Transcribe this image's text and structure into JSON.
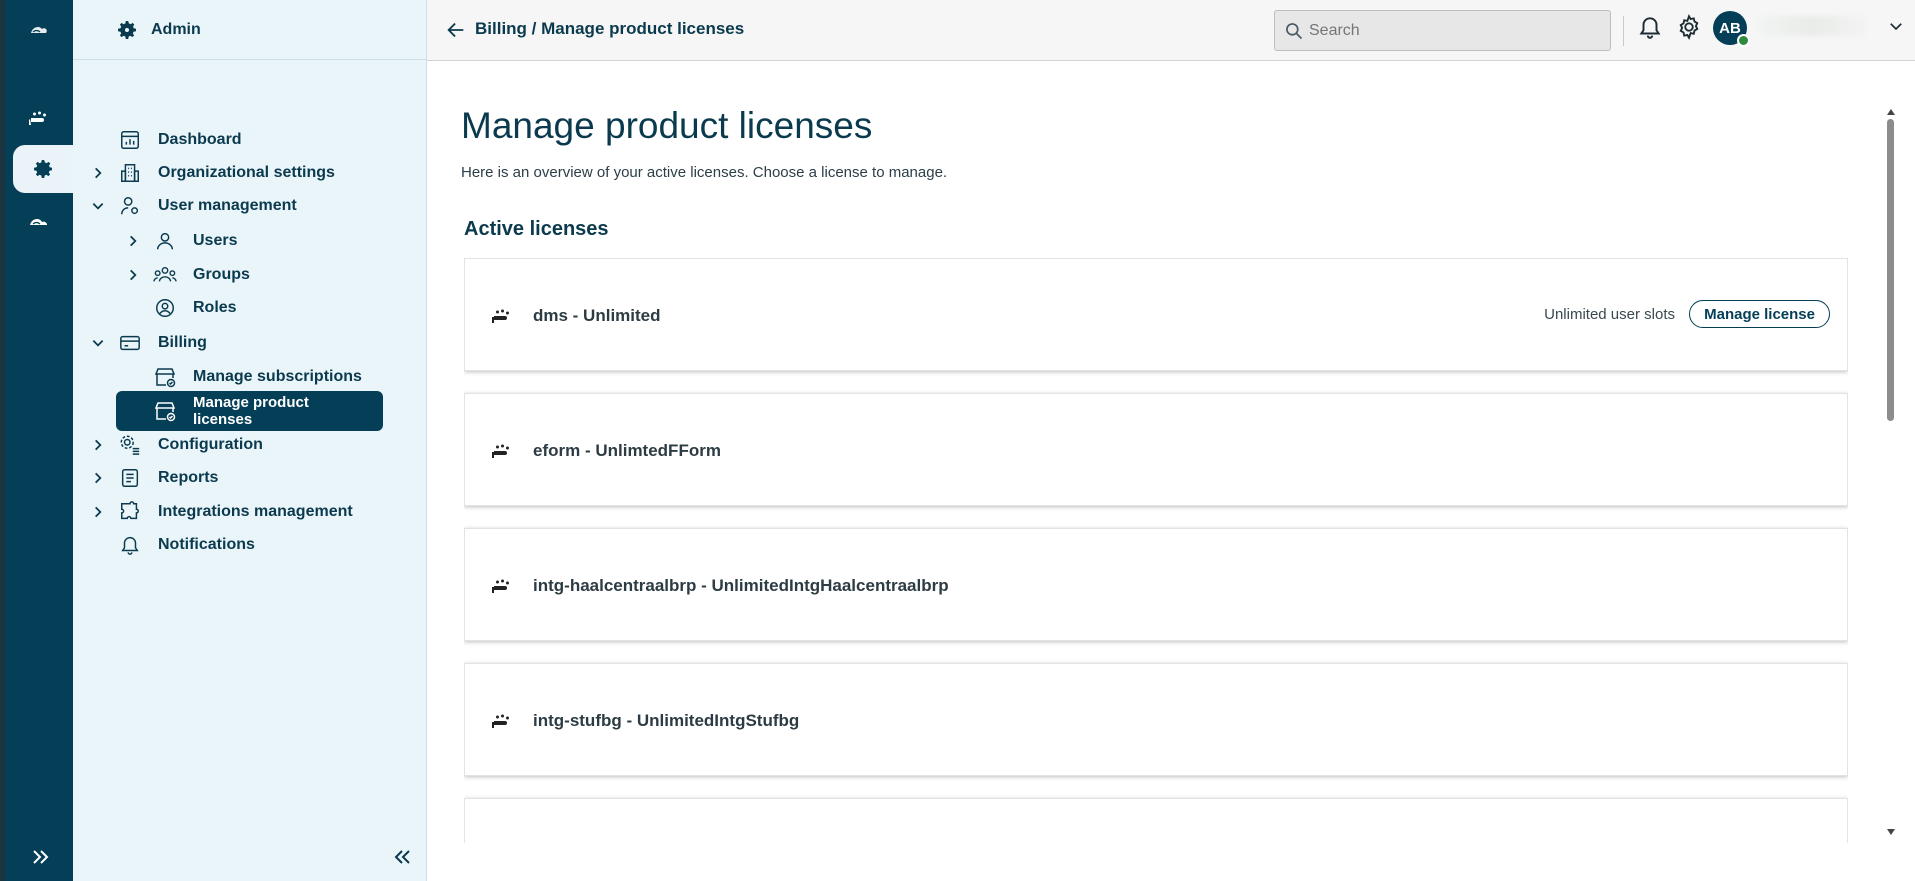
{
  "rail": {
    "items": [
      {
        "icon": "cloud-logo-icon"
      },
      {
        "icon": "hand-icon"
      },
      {
        "icon": "gear-icon"
      },
      {
        "icon": "cloud-icon"
      }
    ],
    "expand_icon": "chevron-double-right-icon"
  },
  "sidebar": {
    "header": "Admin",
    "items": [
      {
        "label": "Dashboard",
        "icon": "dashboard-icon"
      },
      {
        "label": "Organizational settings",
        "icon": "building-icon"
      },
      {
        "label": "User management",
        "icon": "user-gear-icon"
      },
      {
        "label": "Users",
        "icon": "user-icon"
      },
      {
        "label": "Groups",
        "icon": "group-icon"
      },
      {
        "label": "Roles",
        "icon": "role-icon"
      },
      {
        "label": "Billing",
        "icon": "card-icon"
      },
      {
        "label": "Manage subscriptions",
        "icon": "store-icon"
      },
      {
        "label": "Manage product licenses",
        "icon": "store-license-icon"
      },
      {
        "label": "Configuration",
        "icon": "config-icon"
      },
      {
        "label": "Reports",
        "icon": "report-icon"
      },
      {
        "label": "Integrations management",
        "icon": "puzzle-icon"
      },
      {
        "label": "Notifications",
        "icon": "bell-icon"
      }
    ],
    "collapse_icon": "chevron-double-left-icon"
  },
  "topbar": {
    "breadcrumb": "Billing / Manage product licenses",
    "search_placeholder": "Search",
    "avatar_initials": "AB"
  },
  "main": {
    "title": "Manage product licenses",
    "subtitle": "Here is an overview of your active licenses. Choose a license to manage.",
    "section_title": "Active licenses",
    "licenses": [
      {
        "name": "dms - Unlimited",
        "slots": "Unlimited user slots",
        "button": "Manage license"
      },
      {
        "name": "eform - UnlimtedFForm"
      },
      {
        "name": "intg-haalcentraalbrp - UnlimitedIntgHaalcentraalbrp"
      },
      {
        "name": "intg-stufbg - UnlimitedIntgStufbg"
      }
    ]
  },
  "colors": {
    "brand": "#043e57",
    "sidebar_bg": "#eaf5fa",
    "status_online": "#2e8b3d"
  }
}
